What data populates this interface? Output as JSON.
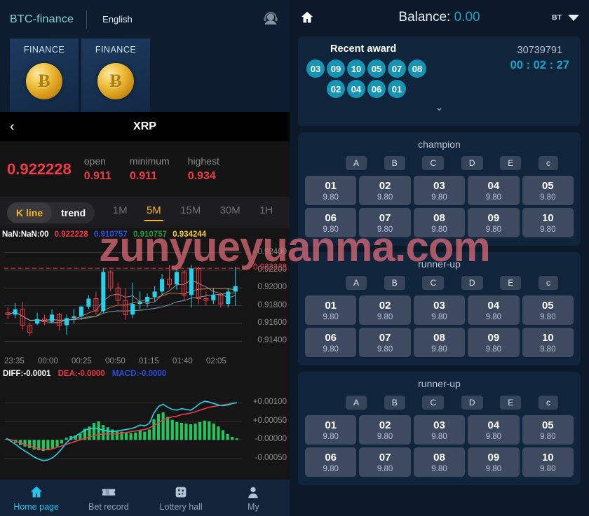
{
  "watermark": "zunyueyuanma.com",
  "left": {
    "header": {
      "brand": "BTC-finance",
      "language": "English",
      "support_icon": "headset-icon"
    },
    "finance_cards": [
      {
        "label": "FINANCE",
        "symbol": "Ƀ"
      },
      {
        "label": "FINANCE",
        "symbol": "Ƀ"
      }
    ],
    "pair_bar": {
      "back_icon": "chevron-left-icon",
      "title": "XRP"
    },
    "quote": {
      "price": "0.922228",
      "stats": [
        {
          "label": "open",
          "value": "0.911"
        },
        {
          "label": "minimum",
          "value": "0.911"
        },
        {
          "label": "highest",
          "value": "0.934"
        }
      ]
    },
    "chart_toggle": {
      "kline": "K line",
      "trend": "trend",
      "active": "K line"
    },
    "timeframes": [
      {
        "label": "1M",
        "active": false
      },
      {
        "label": "5M",
        "active": true
      },
      {
        "label": "15M",
        "active": false
      },
      {
        "label": "30M",
        "active": false
      },
      {
        "label": "1H",
        "active": false
      }
    ],
    "kline_legend": {
      "time": "NaN:NaN:00",
      "open": "0.922228",
      "close": "0.910757",
      "low": "0.910757",
      "high": "0.934244"
    },
    "macd_legend": {
      "diff": "DIFF:-0.0001",
      "dea": "DEA:-0.0000",
      "macd": "MACD:-0.0000"
    },
    "nav": [
      {
        "label": "Home page",
        "icon": "home-icon",
        "active": true
      },
      {
        "label": "Bet record",
        "icon": "ticket-icon",
        "active": false
      },
      {
        "label": "Lottery hall",
        "icon": "dice-icon",
        "active": false
      },
      {
        "label": "My",
        "icon": "person-icon",
        "active": false
      }
    ]
  },
  "chart_data": [
    {
      "type": "candlestick",
      "title": "XRP 5M K line",
      "xlabel": "",
      "ylabel": "",
      "ylim": [
        0.913,
        0.925
      ],
      "yticks": [
        "0.92400",
        "0.92200",
        "0.92000",
        "0.91800",
        "0.91600",
        "0.91400"
      ],
      "xticks": [
        "23:35",
        "00:00",
        "00:25",
        "00:50",
        "01:15",
        "01:40",
        "02:05"
      ],
      "current_price_line": "0.922228",
      "up_color": "#22d3ee",
      "down_color": "#ef3a48",
      "candles": [
        {
          "o": 0.9172,
          "h": 0.9178,
          "l": 0.9165,
          "c": 0.917
        },
        {
          "o": 0.917,
          "h": 0.9183,
          "l": 0.9166,
          "c": 0.9176
        },
        {
          "o": 0.9176,
          "h": 0.9184,
          "l": 0.9152,
          "c": 0.9158
        },
        {
          "o": 0.9158,
          "h": 0.9161,
          "l": 0.9146,
          "c": 0.915
        },
        {
          "o": 0.916,
          "h": 0.9172,
          "l": 0.9158,
          "c": 0.9165
        },
        {
          "o": 0.9165,
          "h": 0.917,
          "l": 0.9158,
          "c": 0.9162
        },
        {
          "o": 0.9162,
          "h": 0.9176,
          "l": 0.916,
          "c": 0.917
        },
        {
          "o": 0.917,
          "h": 0.9172,
          "l": 0.9152,
          "c": 0.9158
        },
        {
          "o": 0.9158,
          "h": 0.917,
          "l": 0.9147,
          "c": 0.9166
        },
        {
          "o": 0.9166,
          "h": 0.9176,
          "l": 0.916,
          "c": 0.9168
        },
        {
          "o": 0.9168,
          "h": 0.918,
          "l": 0.9164,
          "c": 0.9179
        },
        {
          "o": 0.9179,
          "h": 0.9192,
          "l": 0.9176,
          "c": 0.9188
        },
        {
          "o": 0.9188,
          "h": 0.9196,
          "l": 0.917,
          "c": 0.9174
        },
        {
          "o": 0.9174,
          "h": 0.9222,
          "l": 0.9172,
          "c": 0.9218
        },
        {
          "o": 0.9218,
          "h": 0.922,
          "l": 0.9196,
          "c": 0.92
        },
        {
          "o": 0.92,
          "h": 0.9206,
          "l": 0.9182,
          "c": 0.9186
        },
        {
          "o": 0.9186,
          "h": 0.92,
          "l": 0.9164,
          "c": 0.917
        },
        {
          "o": 0.917,
          "h": 0.9206,
          "l": 0.9166,
          "c": 0.9182
        },
        {
          "o": 0.9182,
          "h": 0.9196,
          "l": 0.9176,
          "c": 0.9184
        },
        {
          "o": 0.9184,
          "h": 0.9194,
          "l": 0.9178,
          "c": 0.919
        },
        {
          "o": 0.919,
          "h": 0.9202,
          "l": 0.9184,
          "c": 0.9196
        },
        {
          "o": 0.9196,
          "h": 0.9216,
          "l": 0.9192,
          "c": 0.921
        },
        {
          "o": 0.921,
          "h": 0.9226,
          "l": 0.92,
          "c": 0.9204
        },
        {
          "o": 0.9204,
          "h": 0.9222,
          "l": 0.9198,
          "c": 0.9218
        },
        {
          "o": 0.9218,
          "h": 0.922,
          "l": 0.9186,
          "c": 0.9192
        },
        {
          "o": 0.9192,
          "h": 0.9226,
          "l": 0.9178,
          "c": 0.9222
        },
        {
          "o": 0.9222,
          "h": 0.9224,
          "l": 0.9182,
          "c": 0.9188
        },
        {
          "o": 0.9188,
          "h": 0.9196,
          "l": 0.918,
          "c": 0.9186
        },
        {
          "o": 0.9186,
          "h": 0.92,
          "l": 0.9182,
          "c": 0.9192
        },
        {
          "o": 0.9192,
          "h": 0.9194,
          "l": 0.9178,
          "c": 0.9182
        },
        {
          "o": 0.9182,
          "h": 0.92,
          "l": 0.9178,
          "c": 0.9196
        },
        {
          "o": 0.9196,
          "h": 0.9224,
          "l": 0.918,
          "c": 0.9202
        }
      ]
    },
    {
      "type": "macd",
      "title": "MACD",
      "yticks": [
        "+0.00100",
        "+0.00050",
        "-0.00000",
        "-0.00050"
      ],
      "ylim": [
        -0.00075,
        0.00125
      ],
      "hist_color": "#22c55e",
      "dif_color": "#22d3ee",
      "dea_color": "#ef3a48",
      "histogram": [
        2e-05,
        -2e-05,
        -8e-05,
        -0.00014,
        -0.00018,
        -0.00022,
        -0.00026,
        -0.00028,
        -0.0003,
        -0.00028,
        -0.00024,
        -0.00018,
        -0.0001,
        6e-05,
        0.0001,
        0.00012,
        0.00016,
        0.0003,
        0.00036,
        0.00046,
        0.0005,
        0.0004,
        0.00034,
        0.00028,
        0.00024,
        0.00022,
        0.0002,
        0.00018,
        0.0002,
        0.00026,
        0.00022,
        0.00028,
        0.00056,
        0.0007,
        0.00074,
        0.00062,
        0.00054,
        0.00048,
        0.00046,
        0.00044,
        0.00042,
        0.00044,
        0.00048,
        0.00052,
        0.0005,
        0.00044,
        0.00036,
        0.00026,
        0.00016,
        8e-05,
        4e-05
      ],
      "dif": [
        4e-05,
        -4e-05,
        -0.00012,
        -0.00022,
        -0.0003,
        -0.00038,
        -0.00046,
        -0.00052,
        -0.00056,
        -0.00054,
        -0.00048,
        -0.00038,
        -0.00024,
        -8e-05,
        4e-05,
        0.0001,
        0.00018,
        0.00026,
        0.0003,
        0.00032,
        0.0003,
        0.00026,
        0.00024,
        0.00022,
        0.00024,
        0.00026,
        0.00028,
        0.0003,
        0.00034,
        0.0004,
        0.00038,
        0.00044,
        0.00072,
        0.0009,
        0.00096,
        0.00088,
        0.00082,
        0.0008,
        0.00084,
        0.00082,
        0.0008,
        0.00088,
        0.00098,
        0.00104,
        0.00102,
        0.00098,
        0.00094,
        0.00092,
        0.00094,
        0.00098,
        0.001
      ],
      "dea": [
        2e-05,
        0.0,
        -4e-05,
        -8e-05,
        -0.00012,
        -0.00016,
        -0.0002,
        -0.00024,
        -0.00026,
        -0.00026,
        -0.00024,
        -0.0002,
        -0.00016,
        -0.00012,
        -8e-05,
        -4e-05,
        0.0,
        4e-05,
        8e-05,
        0.00012,
        0.00014,
        0.00016,
        0.00016,
        0.00016,
        0.00016,
        0.00018,
        0.0002,
        0.00022,
        0.00024,
        0.00026,
        0.00028,
        0.00032,
        0.00038,
        0.00046,
        0.00054,
        0.00058,
        0.00062,
        0.00064,
        0.00068,
        0.0007,
        0.00072,
        0.00076,
        0.0008,
        0.00084,
        0.00088,
        0.0009,
        0.00092,
        0.00094,
        0.00096,
        0.00098,
        0.001
      ]
    }
  ],
  "right": {
    "header": {
      "home_icon": "home-icon",
      "balance_label": "Balance:",
      "balance_value": "0.00",
      "currency": "BT",
      "caret_icon": "chevron-down-icon"
    },
    "award": {
      "title": "Recent award",
      "issue": "30739791",
      "countdown": "00 : 02 : 27",
      "balls_row1": [
        "03",
        "09",
        "10",
        "05",
        "07",
        "08"
      ],
      "balls_row2": [
        "02",
        "04",
        "06",
        "01"
      ],
      "expand_icon": "chevron-down-icon"
    },
    "bet_sections": [
      {
        "title": "champion",
        "letters": [
          "A",
          "B",
          "C",
          "D",
          "E",
          "c"
        ],
        "cells": [
          {
            "num": "01",
            "odds": "9.80"
          },
          {
            "num": "02",
            "odds": "9.80"
          },
          {
            "num": "03",
            "odds": "9.80"
          },
          {
            "num": "04",
            "odds": "9.80"
          },
          {
            "num": "05",
            "odds": "9.80"
          },
          {
            "num": "06",
            "odds": "9.80"
          },
          {
            "num": "07",
            "odds": "9.80"
          },
          {
            "num": "08",
            "odds": "9.80"
          },
          {
            "num": "09",
            "odds": "9.80"
          },
          {
            "num": "10",
            "odds": "9.80"
          }
        ]
      },
      {
        "title": "runner-up",
        "letters": [
          "A",
          "B",
          "C",
          "D",
          "E",
          "c"
        ],
        "cells": [
          {
            "num": "01",
            "odds": "9.80"
          },
          {
            "num": "02",
            "odds": "9.80"
          },
          {
            "num": "03",
            "odds": "9.80"
          },
          {
            "num": "04",
            "odds": "9.80"
          },
          {
            "num": "05",
            "odds": "9.80"
          },
          {
            "num": "06",
            "odds": "9.80"
          },
          {
            "num": "07",
            "odds": "9.80"
          },
          {
            "num": "08",
            "odds": "9.80"
          },
          {
            "num": "09",
            "odds": "9.80"
          },
          {
            "num": "10",
            "odds": "9.80"
          }
        ]
      },
      {
        "title": "runner-up",
        "letters": [
          "A",
          "B",
          "C",
          "D",
          "E",
          "c"
        ],
        "cells": [
          {
            "num": "01",
            "odds": "9.80"
          },
          {
            "num": "02",
            "odds": "9.80"
          },
          {
            "num": "03",
            "odds": "9.80"
          },
          {
            "num": "04",
            "odds": "9.80"
          },
          {
            "num": "05",
            "odds": "9.80"
          },
          {
            "num": "06",
            "odds": "9.80"
          },
          {
            "num": "07",
            "odds": "9.80"
          },
          {
            "num": "08",
            "odds": "9.80"
          },
          {
            "num": "09",
            "odds": "9.80"
          },
          {
            "num": "10",
            "odds": "9.80"
          }
        ]
      }
    ]
  }
}
